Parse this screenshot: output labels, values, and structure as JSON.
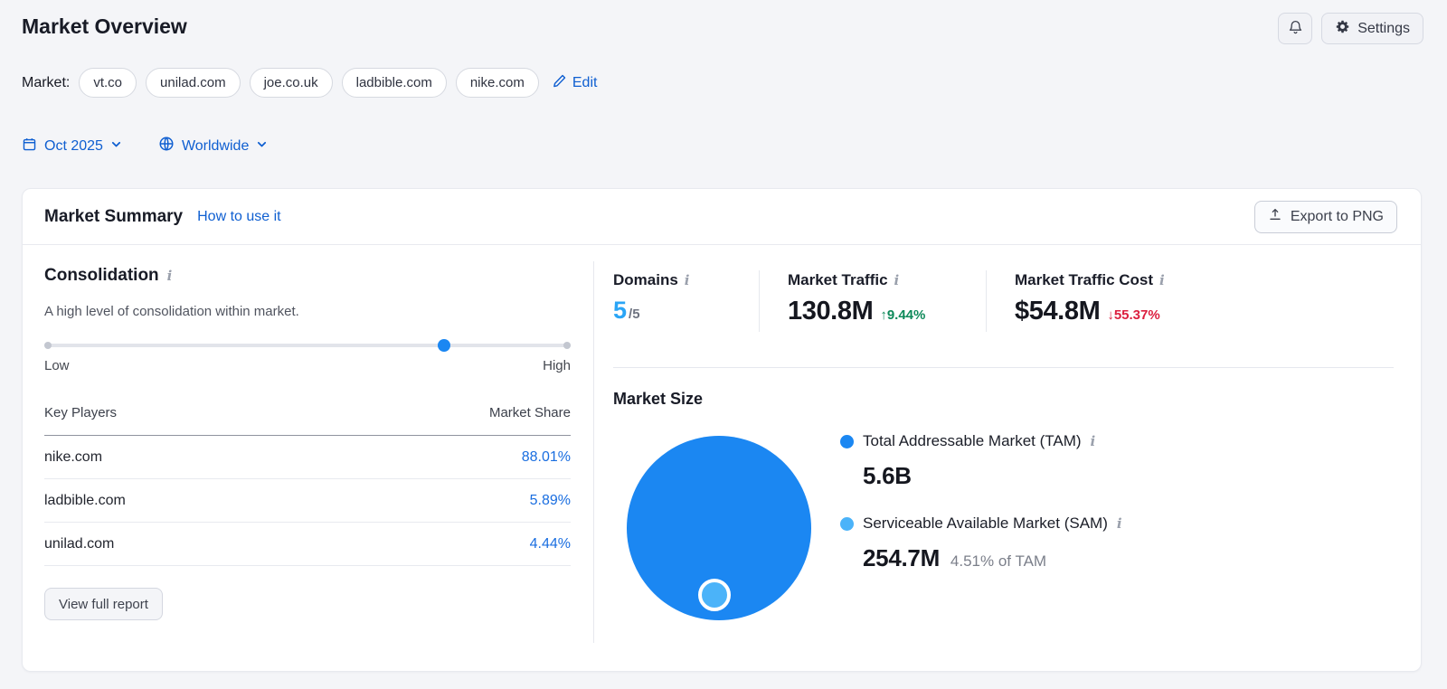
{
  "page": {
    "title": "Market Overview"
  },
  "header": {
    "settings_label": "Settings"
  },
  "ui": {
    "info_glyph": "i"
  },
  "market": {
    "label": "Market:",
    "domains": [
      "vt.co",
      "unilad.com",
      "joe.co.uk",
      "ladbible.com",
      "nike.com"
    ],
    "edit_label": "Edit"
  },
  "filters": {
    "date": "Oct 2025",
    "region": "Worldwide"
  },
  "summary_card": {
    "title": "Market Summary",
    "help_link": "How to use it",
    "export_label": "Export to PNG",
    "consolidation": {
      "title": "Consolidation",
      "description": "A high level of consolidation within market.",
      "slider": {
        "low_label": "Low",
        "high_label": "High",
        "value_pct": 76,
        "thumb_style": "left:76%"
      },
      "table": {
        "col_player": "Key Players",
        "col_share": "Market Share",
        "rows": [
          {
            "domain": "nike.com",
            "share": "88.01%"
          },
          {
            "domain": "ladbible.com",
            "share": "5.89%"
          },
          {
            "domain": "unilad.com",
            "share": "4.44%"
          }
        ]
      },
      "view_report_label": "View full report"
    },
    "metrics": {
      "domains": {
        "label": "Domains",
        "value": "5",
        "total": "/5"
      },
      "traffic": {
        "label": "Market Traffic",
        "value": "130.8M",
        "change": "↑9.44%"
      },
      "traffic_cost": {
        "label": "Market Traffic Cost",
        "value": "$54.8M",
        "change": "↓55.37%"
      }
    },
    "market_size": {
      "title": "Market Size",
      "tam": {
        "label": "Total Addressable Market (TAM)",
        "value": "5.6B"
      },
      "sam": {
        "label": "Serviceable Available Market (SAM)",
        "value": "254.7M",
        "note": "4.51% of TAM"
      }
    }
  },
  "colors": {
    "tam_blue": "#1b87f2",
    "sam_blue": "#4bb3f9",
    "link_blue": "#0f5fd1",
    "share_link_blue": "#1a6ee0",
    "domains_count_blue": "#2aa5f6",
    "positive_green": "#0e8a5a",
    "negative_red": "#dc1f3f"
  },
  "chart_data": {
    "type": "bubble",
    "title": "Market Size",
    "legend_position": "right",
    "series": [
      {
        "name": "Total Addressable Market (TAM)",
        "value": 5600000000,
        "label": "5.6B",
        "color": "#1b87f2"
      },
      {
        "name": "Serviceable Available Market (SAM)",
        "value": 254700000,
        "label": "254.7M",
        "pct_of_tam": "4.51%",
        "color": "#4bb3f9"
      }
    ],
    "layout_hint": "SAM bubble nested at bottom center of TAM bubble; radius proportional to sqrt(value)"
  }
}
